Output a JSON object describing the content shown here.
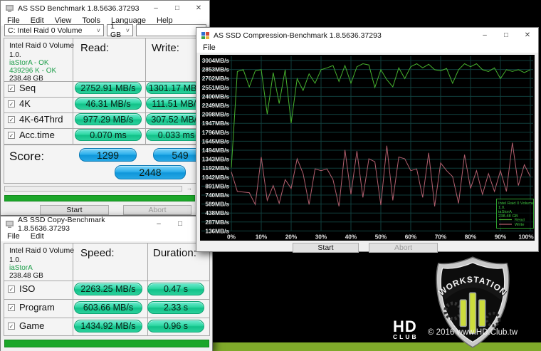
{
  "desktop": {
    "shield_text": "WORKSTATION",
    "hd_logo": {
      "hd": "HD",
      "club": "CLUB"
    },
    "copyright": "© 2016  www.HD.Club.tw",
    "strip_color": "#7fa92a"
  },
  "icons": {
    "minimize": "–",
    "maximize": "□",
    "close": "✕",
    "chevron": "˅",
    "check": "✓",
    "status_arrow": "→"
  },
  "main_window": {
    "title": "AS SSD Benchmark 1.8.5636.37293",
    "menu": [
      "File",
      "Edit",
      "View",
      "Tools",
      "Language",
      "Help"
    ],
    "drive_select": "C: Intel Raid 0 Volume",
    "size_select": "1 GB",
    "textbox_value": "",
    "drive_info": {
      "name": "Intel Raid 0 Volume",
      "version": "1.0.",
      "driver": "iaStorA - OK",
      "alignment": "439296 K - OK",
      "capacity": "238.48 GB"
    },
    "col_read": "Read:",
    "col_write": "Write:",
    "rows": [
      {
        "label": "Seq",
        "read": "2752.91 MB/s",
        "write": "1301.17 MB/s"
      },
      {
        "label": "4K",
        "read": "46.31 MB/s",
        "write": "111.51 MB/s"
      },
      {
        "label": "4K-64Thrd",
        "read": "977.29 MB/s",
        "write": "307.52 MB/s"
      },
      {
        "label": "Acc.time",
        "read": "0.070 ms",
        "write": "0.033 ms"
      }
    ],
    "score_label": "Score:",
    "score_read": "1299",
    "score_write": "549",
    "score_total": "2448",
    "start_label": "Start",
    "abort_label": "Abort"
  },
  "copy_window": {
    "title": "AS SSD Copy-Benchmark 1.8.5636.37293",
    "menu": [
      "File",
      "Edit"
    ],
    "drive_info": {
      "name": "Intel Raid 0 Volume",
      "version": "1.0.",
      "driver": "iaStorA",
      "capacity": "238.48 GB"
    },
    "col_speed": "Speed:",
    "col_duration": "Duration:",
    "rows": [
      {
        "label": "ISO",
        "speed": "2263.25 MB/s",
        "duration": "0.47 s"
      },
      {
        "label": "Program",
        "speed": "603.66 MB/s",
        "duration": "2.33 s"
      },
      {
        "label": "Game",
        "speed": "1434.92 MB/s",
        "duration": "0.96 s"
      }
    ]
  },
  "compression_window": {
    "title": "AS SSD Compression-Benchmark 1.8.5636.37293",
    "menu": [
      "File"
    ],
    "legend": {
      "lines": [
        "Intel Raid 0 Volume",
        "1.0.",
        "iaStorA",
        "238.48 GB"
      ]
    },
    "start_label": "Start",
    "abort_label": "Abort"
  },
  "chart_data": {
    "type": "line",
    "title": "",
    "xlabel": "",
    "ylabel": "",
    "grid": true,
    "bg": "#000000",
    "grid_color": "#113e3c",
    "legend_position": "bottom-right",
    "y_top": 3004,
    "y_step": 151,
    "ylim": [
      60,
      3080
    ],
    "ylabels": [
      "3004MB/s",
      "2853MB/s",
      "2702MB/s",
      "2551MB/s",
      "2400MB/s",
      "2249MB/s",
      "2098MB/s",
      "1947MB/s",
      "1796MB/s",
      "1645MB/s",
      "1494MB/s",
      "1343MB/s",
      "1192MB/s",
      "1042MB/s",
      "891MB/s",
      "740MB/s",
      "589MB/s",
      "438MB/s",
      "287MB/s",
      "136MB/s"
    ],
    "xlabels": [
      "0%",
      "10%",
      "20%",
      "30%",
      "40%",
      "50%",
      "60%",
      "70%",
      "80%",
      "90%",
      "100%"
    ],
    "x": [
      0,
      2,
      4,
      6,
      8,
      10,
      12,
      14,
      16,
      18,
      20,
      22,
      24,
      26,
      28,
      30,
      32,
      34,
      36,
      38,
      40,
      42,
      44,
      46,
      48,
      50,
      52,
      54,
      56,
      58,
      60,
      62,
      64,
      66,
      68,
      70,
      72,
      74,
      76,
      78,
      80,
      82,
      84,
      86,
      88,
      90,
      92,
      94,
      96,
      98,
      100
    ],
    "series": [
      {
        "name": "Read",
        "color": "#46b12e",
        "values": [
          1200,
          2820,
          2850,
          2560,
          2830,
          2850,
          2100,
          2800,
          2280,
          2850,
          1950,
          2700,
          2500,
          2780,
          2620,
          2850,
          2880,
          2920,
          2650,
          2920,
          2620,
          2900,
          2950,
          2930,
          2550,
          2850,
          2680,
          2560,
          2880,
          2700,
          2900,
          2950,
          2880,
          2940,
          2850,
          2830,
          2870,
          2620,
          2850,
          2950,
          2900,
          2950,
          2850,
          2820,
          2880,
          2700,
          2850,
          2820,
          2850,
          2800,
          2850
        ]
      },
      {
        "name": "Write",
        "color": "#b25f6e",
        "values": [
          1130,
          800,
          790,
          780,
          580,
          1380,
          650,
          900,
          600,
          1000,
          850,
          1350,
          1100,
          580,
          1180,
          1150,
          1180,
          1000,
          550,
          1500,
          750,
          1480,
          700,
          1350,
          1300,
          570,
          1570,
          650,
          1380,
          1350,
          1150,
          1180,
          700,
          1450,
          550,
          1280,
          1150,
          1050,
          600,
          1420,
          850,
          1150,
          750,
          1100,
          800,
          1150,
          800,
          1620,
          900,
          1250,
          1050
        ]
      }
    ]
  }
}
